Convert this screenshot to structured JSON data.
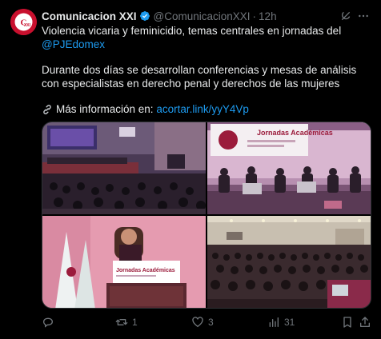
{
  "post": {
    "author_name": "Comunicacion XXI",
    "handle": "@ComunicacionXXI",
    "separator": "·",
    "time": "12h",
    "text_line1": "Violencia vicaria y feminicidio, temas centrales en jornadas del",
    "mention": "@PJEdomex",
    "text_para2": "Durante dos días se desarrollan conferencias y mesas de análisis con especialistas en derecho penal y derechos de las mujeres",
    "info_label": "Más información en:",
    "info_link": "acortar.link/yyY4Vp"
  },
  "media": {
    "image_text": {
      "banner_title": "Jornadas Académicas",
      "podium_title": "Jornadas Académicas"
    }
  },
  "actions": {
    "reply_count": "",
    "repost_count": "1",
    "like_count": "3",
    "views_count": "31"
  },
  "colors": {
    "background": "#000000",
    "text": "#e7e9ea",
    "muted": "#71767b",
    "link": "#1d9bf0",
    "avatar": "#c8102e"
  },
  "icons": [
    "avatar-logo",
    "verified-icon",
    "grok-icon",
    "more-icon",
    "link-icon",
    "reply-icon",
    "repost-icon",
    "like-icon",
    "views-icon",
    "bookmark-icon",
    "share-icon"
  ]
}
